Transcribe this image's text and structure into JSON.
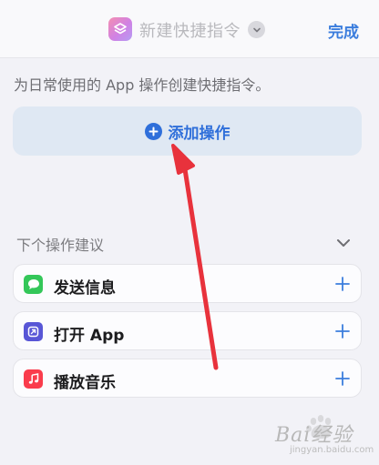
{
  "header": {
    "title": "新建快捷指令",
    "done_label": "完成",
    "app_icon": "shortcuts-layers-icon",
    "title_menu_icon": "chevron-down-icon"
  },
  "description": "为日常使用的 App 操作创建快捷指令。",
  "add_action": {
    "label": "添加操作",
    "icon": "plus-circle-icon"
  },
  "suggestions": {
    "header": "下个操作建议",
    "collapse_icon": "chevron-down-icon",
    "items": [
      {
        "label": "发送信息",
        "icon": "messages-icon",
        "icon_color": "#34c759"
      },
      {
        "label": "打开 App",
        "icon": "open-app-icon",
        "icon_color": "#5856d6"
      },
      {
        "label": "播放音乐",
        "icon": "music-icon",
        "icon_color": "#fa3c4c"
      }
    ],
    "add_icon": "plus-icon"
  },
  "annotation": {
    "arrow_color": "#e8323c"
  },
  "watermark": {
    "text": "Bai经验",
    "url": "jingyan.baidu.com"
  },
  "colors": {
    "accent": "#2f6fda",
    "done": "#3b7ddd",
    "background": "#f2f2f7"
  }
}
